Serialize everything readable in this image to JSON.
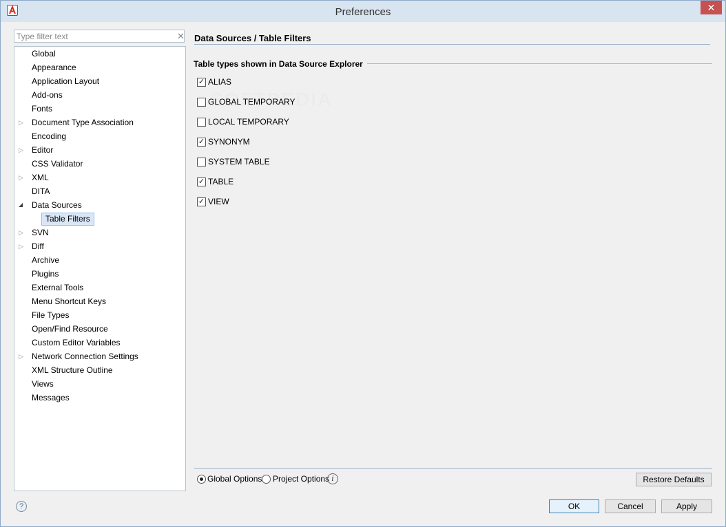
{
  "window": {
    "title": "Preferences"
  },
  "filter": {
    "placeholder": "Type filter text"
  },
  "tree": [
    {
      "label": "Global",
      "expand": ""
    },
    {
      "label": "Appearance",
      "expand": ""
    },
    {
      "label": "Application Layout",
      "expand": ""
    },
    {
      "label": "Add-ons",
      "expand": ""
    },
    {
      "label": "Fonts",
      "expand": ""
    },
    {
      "label": "Document Type Association",
      "expand": "collapsed"
    },
    {
      "label": "Encoding",
      "expand": ""
    },
    {
      "label": "Editor",
      "expand": "collapsed"
    },
    {
      "label": "CSS Validator",
      "expand": ""
    },
    {
      "label": "XML",
      "expand": "collapsed"
    },
    {
      "label": "DITA",
      "expand": ""
    },
    {
      "label": "Data Sources",
      "expand": "expanded"
    },
    {
      "label": "Table Filters",
      "expand": "",
      "selected": true,
      "child": true
    },
    {
      "label": "SVN",
      "expand": "collapsed"
    },
    {
      "label": "Diff",
      "expand": "collapsed"
    },
    {
      "label": "Archive",
      "expand": ""
    },
    {
      "label": "Plugins",
      "expand": ""
    },
    {
      "label": "External Tools",
      "expand": ""
    },
    {
      "label": "Menu Shortcut Keys",
      "expand": ""
    },
    {
      "label": "File Types",
      "expand": ""
    },
    {
      "label": "Open/Find Resource",
      "expand": ""
    },
    {
      "label": "Custom Editor Variables",
      "expand": ""
    },
    {
      "label": "Network Connection Settings",
      "expand": "collapsed"
    },
    {
      "label": "XML Structure Outline",
      "expand": ""
    },
    {
      "label": "Views",
      "expand": ""
    },
    {
      "label": "Messages",
      "expand": ""
    }
  ],
  "page": {
    "title": "Data Sources / Table Filters",
    "group_label": "Table types shown in Data Source Explorer",
    "options": [
      {
        "label": "ALIAS",
        "checked": true
      },
      {
        "label": "GLOBAL TEMPORARY",
        "checked": false
      },
      {
        "label": "LOCAL TEMPORARY",
        "checked": false
      },
      {
        "label": "SYNONYM",
        "checked": true
      },
      {
        "label": "SYSTEM TABLE",
        "checked": false
      },
      {
        "label": "TABLE",
        "checked": true
      },
      {
        "label": "VIEW",
        "checked": true
      }
    ]
  },
  "scope": {
    "global_label": "Global Options",
    "project_label": "Project Options",
    "selected": "global"
  },
  "buttons": {
    "restore": "Restore Defaults",
    "ok": "OK",
    "cancel": "Cancel",
    "apply": "Apply"
  },
  "watermark": "SOFTPEDIA"
}
